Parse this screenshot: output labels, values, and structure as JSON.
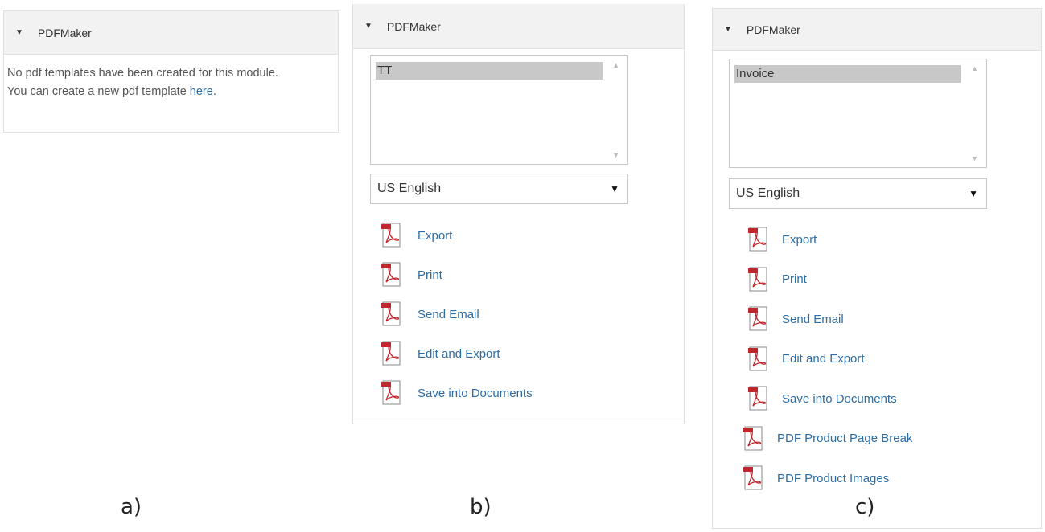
{
  "panel_a": {
    "title": "PDFMaker",
    "message": "No pdf templates have been created for this module. You can create a new pdf template ",
    "link": "here",
    "message_end": "."
  },
  "panel_b": {
    "title": "PDFMaker",
    "template_selected": "TT",
    "language": "US English",
    "actions": [
      "Export",
      "Print",
      "Send Email",
      "Edit and Export",
      "Save into Documents"
    ]
  },
  "panel_c": {
    "title": "PDFMaker",
    "template_selected": "Invoice",
    "language": "US English",
    "actions": [
      "Export",
      "Print",
      "Send Email",
      "Edit and Export",
      "Save into Documents",
      "PDF Product Page Break",
      "PDF Product Images"
    ]
  },
  "captions": {
    "a": "a)",
    "b": "b)",
    "c": "c)"
  },
  "icon_names": [
    "pdf-export-icon",
    "pdf-print-icon",
    "pdf-email-icon",
    "pdf-edit-icon",
    "pdf-save-icon",
    "pdf-page-break-icon",
    "pdf-images-icon"
  ],
  "colors": {
    "link": "#2e6da4",
    "header_bg": "#f2f2f2",
    "pdf_red": "#c0272d"
  }
}
